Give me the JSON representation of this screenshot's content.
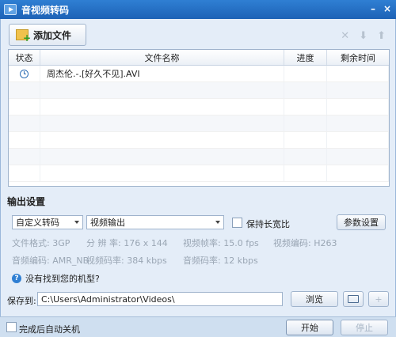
{
  "window": {
    "title": "音视频转码",
    "minimize_glyph": "–",
    "close_glyph": "×"
  },
  "toolbar": {
    "add_file_label": "添加文件",
    "remove_glyph": "✕",
    "down_glyph": "⬇",
    "up_glyph": "⬆"
  },
  "list": {
    "headers": {
      "status": "状态",
      "filename": "文件名称",
      "progress": "进度",
      "remaining": "剩余时间"
    },
    "rows": [
      {
        "status_icon": "clock-icon",
        "filename": "周杰伦.-.[好久不见].AVI",
        "progress": "",
        "remaining": ""
      }
    ]
  },
  "output": {
    "section_title": "输出设置",
    "preset_value": "自定义转码",
    "format_value": "视频输出",
    "keep_ratio_label": "保持长宽比",
    "params_button": "参数设置",
    "info": {
      "file_format": "文件格式:  3GP",
      "resolution": "分 辨 率:  176 x 144",
      "frame_rate": "视频帧率:  15.0 fps",
      "video_codec": "视频编码:  H263",
      "audio_codec": "音频编码:  AMR_NB",
      "video_bitrate": "视频码率:  384 kbps",
      "audio_bitrate": "音频码率:  12 kbps"
    },
    "help_text": "没有找到您的机型?"
  },
  "save": {
    "label": "保存到:",
    "path": "C:\\Users\\Administrator\\Videos\\",
    "browse_button": "浏览"
  },
  "footer": {
    "shutdown_label": "完成后自动关机",
    "start_button": "开始",
    "stop_button": "停止"
  }
}
